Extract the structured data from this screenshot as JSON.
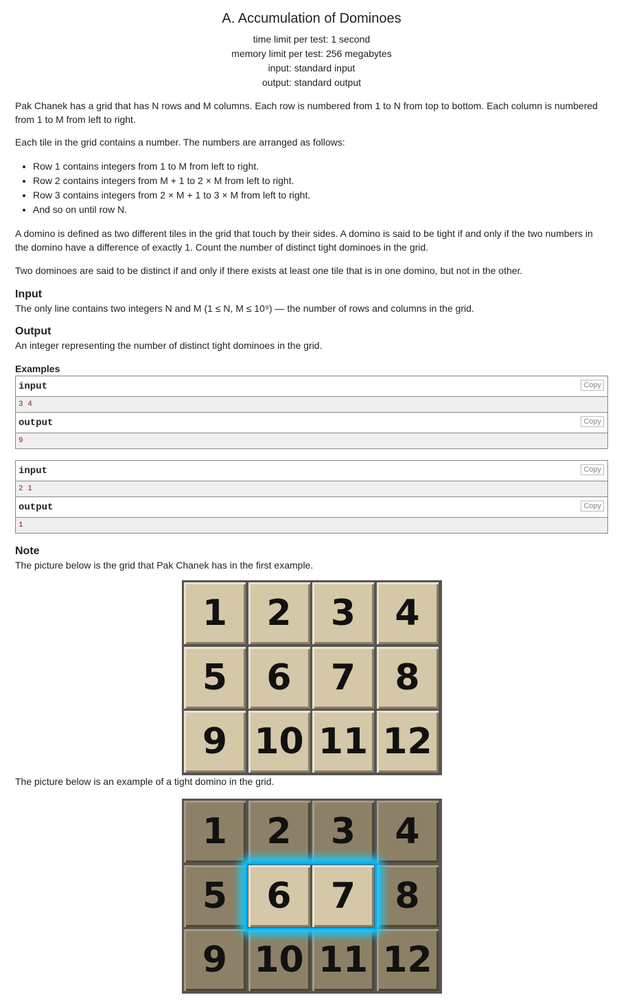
{
  "problem": {
    "title": "A. Accumulation of Dominoes",
    "time_limit": "time limit per test: 1 second",
    "memory_limit": "memory limit per test: 256 megabytes",
    "input_type": "input: standard input",
    "output_type": "output: standard output"
  },
  "statement": {
    "intro": "Pak Chanek has a grid that has N rows and M columns. Each row is numbered from 1 to N from top to bottom. Each column is numbered from 1 to M from left to right.",
    "arranged": "Each tile in the grid contains a number. The numbers are arranged as follows:",
    "rows": [
      "Row 1 contains integers from 1 to M from left to right.",
      "Row 2 contains integers from M + 1 to 2 × M from left to right.",
      "Row 3 contains integers from 2 × M + 1 to 3 × M from left to right.",
      "And so on until row N."
    ],
    "domino": "A domino is defined as two different tiles in the grid that touch by their sides. A domino is said to be tight if and only if the two numbers in the domino have a difference of exactly 1. Count the number of distinct tight dominoes in the grid.",
    "distinct": "Two dominoes are said to be distinct if and only if there exists at least one tile that is in one domino, but not in the other."
  },
  "input_section": {
    "heading": "Input",
    "text": "The only line contains two integers N and M (1 ≤ N, M ≤ 10⁹) — the number of rows and columns in the grid."
  },
  "output_section": {
    "heading": "Output",
    "text": "An integer representing the number of distinct tight dominoes in the grid."
  },
  "examples": {
    "heading": "Examples",
    "input_label": "input",
    "output_label": "output",
    "copy_label": "Copy",
    "tests": [
      {
        "input": "3 4",
        "output": "9"
      },
      {
        "input": "2 1",
        "output": "1"
      }
    ]
  },
  "note": {
    "heading": "Note",
    "text1": "The picture below is the grid that Pak Chanek has in the first example.",
    "text2": "The picture below is an example of a tight domino in the grid."
  },
  "grid_numbers": [
    "1",
    "2",
    "3",
    "4",
    "5",
    "6",
    "7",
    "8",
    "9",
    "10",
    "11",
    "12"
  ],
  "highlighted_tiles": [
    "6",
    "7"
  ],
  "colors": {
    "glow": "#11ccff",
    "tile": "#d4c8a8",
    "tile_dark": "#8c8166"
  }
}
